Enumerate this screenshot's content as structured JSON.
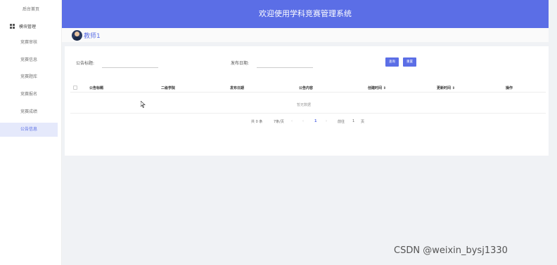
{
  "sidebar": {
    "home": "后台首页",
    "group_label": "模块管理",
    "items": [
      "竞赛审核",
      "竞赛信息",
      "竞赛题库",
      "竞赛报名",
      "竞赛成绩",
      "公告信息"
    ],
    "active_index": 5
  },
  "header": {
    "title": "欢迎使用学科竞赛管理系统"
  },
  "user": {
    "name": "教师1"
  },
  "search": {
    "title_label": "公告标题:",
    "title_value": "",
    "date_label": "发布日期:",
    "date_value": "",
    "query_button": "查询",
    "reset_button": "重置"
  },
  "table": {
    "columns": [
      "公告标题",
      "二级学院",
      "发布日期",
      "公告内容",
      "创建时间 ⇕",
      "更新时间 ⇕",
      "操作"
    ],
    "empty_text": "暂无数据"
  },
  "pagination": {
    "total": "共 0 条",
    "page_size": "7条/页",
    "prev": "‹",
    "current": "1",
    "next": "›",
    "goto_label": "前往",
    "goto_value": "1",
    "goto_suffix": "页"
  },
  "watermark": "CSDN @weixin_bysj1330",
  "colors": {
    "accent": "#5b6ee6",
    "active_bg": "#e5e9fb"
  }
}
